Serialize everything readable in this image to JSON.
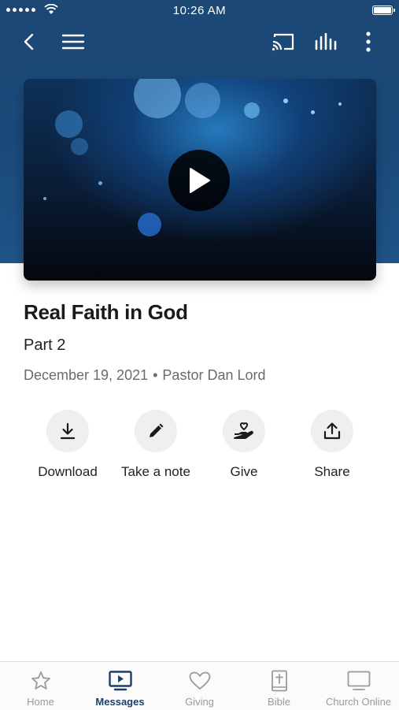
{
  "status_bar": {
    "time": "10:26 AM"
  },
  "top_nav": {
    "icons": [
      "back-arrow-icon",
      "hamburger-menu-icon",
      "cast-icon",
      "audio-bars-icon",
      "more-vertical-icon"
    ]
  },
  "video": {
    "play_icon": "play-icon"
  },
  "message": {
    "title": "Real Faith in God",
    "subtitle": "Part 2",
    "date": "December 19, 2021",
    "separator": "•",
    "speaker": "Pastor Dan Lord"
  },
  "actions": [
    {
      "label": "Download",
      "icon": "download-icon"
    },
    {
      "label": "Take a note",
      "icon": "pencil-icon"
    },
    {
      "label": "Give",
      "icon": "hand-heart-icon"
    },
    {
      "label": "Share",
      "icon": "share-icon"
    }
  ],
  "tabs": [
    {
      "label": "Home",
      "icon": "star-icon"
    },
    {
      "label": "Messages",
      "icon": "tv-play-icon",
      "active": true
    },
    {
      "label": "Giving",
      "icon": "heart-icon"
    },
    {
      "label": "Bible",
      "icon": "bible-icon"
    },
    {
      "label": "Church Online",
      "icon": "monitor-icon"
    }
  ],
  "colors": {
    "header": "#1d4876",
    "active_tab": "#1a3f6b",
    "inactive_tab": "#9a9a9a"
  }
}
